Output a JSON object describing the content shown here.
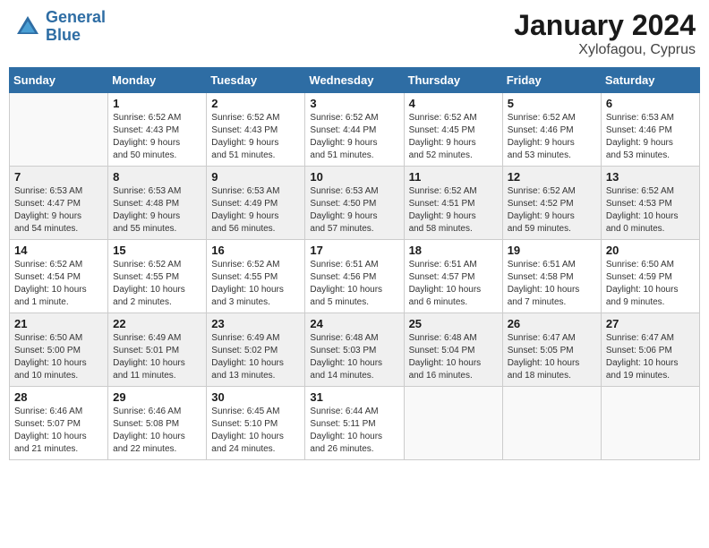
{
  "header": {
    "logo_line1": "General",
    "logo_line2": "Blue",
    "title": "January 2024",
    "location": "Xylofagou, Cyprus"
  },
  "days_of_week": [
    "Sunday",
    "Monday",
    "Tuesday",
    "Wednesday",
    "Thursday",
    "Friday",
    "Saturday"
  ],
  "weeks": [
    [
      {
        "day": "",
        "info": ""
      },
      {
        "day": "1",
        "info": "Sunrise: 6:52 AM\nSunset: 4:43 PM\nDaylight: 9 hours\nand 50 minutes."
      },
      {
        "day": "2",
        "info": "Sunrise: 6:52 AM\nSunset: 4:43 PM\nDaylight: 9 hours\nand 51 minutes."
      },
      {
        "day": "3",
        "info": "Sunrise: 6:52 AM\nSunset: 4:44 PM\nDaylight: 9 hours\nand 51 minutes."
      },
      {
        "day": "4",
        "info": "Sunrise: 6:52 AM\nSunset: 4:45 PM\nDaylight: 9 hours\nand 52 minutes."
      },
      {
        "day": "5",
        "info": "Sunrise: 6:52 AM\nSunset: 4:46 PM\nDaylight: 9 hours\nand 53 minutes."
      },
      {
        "day": "6",
        "info": "Sunrise: 6:53 AM\nSunset: 4:46 PM\nDaylight: 9 hours\nand 53 minutes."
      }
    ],
    [
      {
        "day": "7",
        "info": "Sunrise: 6:53 AM\nSunset: 4:47 PM\nDaylight: 9 hours\nand 54 minutes."
      },
      {
        "day": "8",
        "info": "Sunrise: 6:53 AM\nSunset: 4:48 PM\nDaylight: 9 hours\nand 55 minutes."
      },
      {
        "day": "9",
        "info": "Sunrise: 6:53 AM\nSunset: 4:49 PM\nDaylight: 9 hours\nand 56 minutes."
      },
      {
        "day": "10",
        "info": "Sunrise: 6:53 AM\nSunset: 4:50 PM\nDaylight: 9 hours\nand 57 minutes."
      },
      {
        "day": "11",
        "info": "Sunrise: 6:52 AM\nSunset: 4:51 PM\nDaylight: 9 hours\nand 58 minutes."
      },
      {
        "day": "12",
        "info": "Sunrise: 6:52 AM\nSunset: 4:52 PM\nDaylight: 9 hours\nand 59 minutes."
      },
      {
        "day": "13",
        "info": "Sunrise: 6:52 AM\nSunset: 4:53 PM\nDaylight: 10 hours\nand 0 minutes."
      }
    ],
    [
      {
        "day": "14",
        "info": "Sunrise: 6:52 AM\nSunset: 4:54 PM\nDaylight: 10 hours\nand 1 minute."
      },
      {
        "day": "15",
        "info": "Sunrise: 6:52 AM\nSunset: 4:55 PM\nDaylight: 10 hours\nand 2 minutes."
      },
      {
        "day": "16",
        "info": "Sunrise: 6:52 AM\nSunset: 4:55 PM\nDaylight: 10 hours\nand 3 minutes."
      },
      {
        "day": "17",
        "info": "Sunrise: 6:51 AM\nSunset: 4:56 PM\nDaylight: 10 hours\nand 5 minutes."
      },
      {
        "day": "18",
        "info": "Sunrise: 6:51 AM\nSunset: 4:57 PM\nDaylight: 10 hours\nand 6 minutes."
      },
      {
        "day": "19",
        "info": "Sunrise: 6:51 AM\nSunset: 4:58 PM\nDaylight: 10 hours\nand 7 minutes."
      },
      {
        "day": "20",
        "info": "Sunrise: 6:50 AM\nSunset: 4:59 PM\nDaylight: 10 hours\nand 9 minutes."
      }
    ],
    [
      {
        "day": "21",
        "info": "Sunrise: 6:50 AM\nSunset: 5:00 PM\nDaylight: 10 hours\nand 10 minutes."
      },
      {
        "day": "22",
        "info": "Sunrise: 6:49 AM\nSunset: 5:01 PM\nDaylight: 10 hours\nand 11 minutes."
      },
      {
        "day": "23",
        "info": "Sunrise: 6:49 AM\nSunset: 5:02 PM\nDaylight: 10 hours\nand 13 minutes."
      },
      {
        "day": "24",
        "info": "Sunrise: 6:48 AM\nSunset: 5:03 PM\nDaylight: 10 hours\nand 14 minutes."
      },
      {
        "day": "25",
        "info": "Sunrise: 6:48 AM\nSunset: 5:04 PM\nDaylight: 10 hours\nand 16 minutes."
      },
      {
        "day": "26",
        "info": "Sunrise: 6:47 AM\nSunset: 5:05 PM\nDaylight: 10 hours\nand 18 minutes."
      },
      {
        "day": "27",
        "info": "Sunrise: 6:47 AM\nSunset: 5:06 PM\nDaylight: 10 hours\nand 19 minutes."
      }
    ],
    [
      {
        "day": "28",
        "info": "Sunrise: 6:46 AM\nSunset: 5:07 PM\nDaylight: 10 hours\nand 21 minutes."
      },
      {
        "day": "29",
        "info": "Sunrise: 6:46 AM\nSunset: 5:08 PM\nDaylight: 10 hours\nand 22 minutes."
      },
      {
        "day": "30",
        "info": "Sunrise: 6:45 AM\nSunset: 5:10 PM\nDaylight: 10 hours\nand 24 minutes."
      },
      {
        "day": "31",
        "info": "Sunrise: 6:44 AM\nSunset: 5:11 PM\nDaylight: 10 hours\nand 26 minutes."
      },
      {
        "day": "",
        "info": ""
      },
      {
        "day": "",
        "info": ""
      },
      {
        "day": "",
        "info": ""
      }
    ]
  ]
}
